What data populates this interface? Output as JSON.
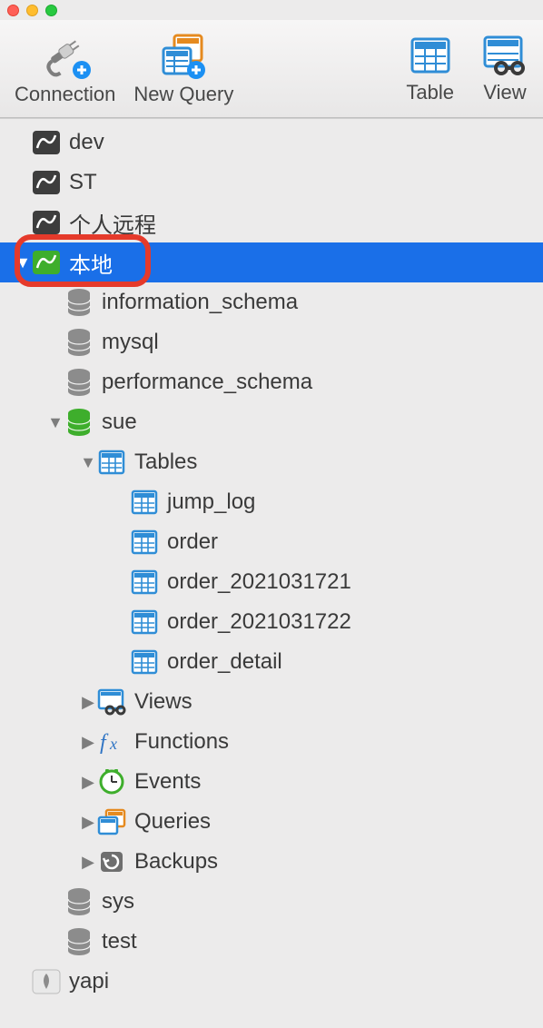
{
  "toolbar": {
    "connection": "Connection",
    "new_query": "New Query",
    "table": "Table",
    "view": "View"
  },
  "colors": {
    "selection": "#1a6fe8",
    "highlight_border": "#e53a2b",
    "db_active": "#3eae2c",
    "db_inactive": "#8c8c8c"
  },
  "tree": [
    {
      "indent": 0,
      "arrow": "",
      "icon": "mysql-dark",
      "label": "dev",
      "selected": false
    },
    {
      "indent": 0,
      "arrow": "",
      "icon": "mysql-dark",
      "label": "ST",
      "selected": false
    },
    {
      "indent": 0,
      "arrow": "",
      "icon": "mysql-dark",
      "label": "个人远程",
      "selected": false
    },
    {
      "indent": 0,
      "arrow": "down",
      "icon": "mysql-green",
      "label": "本地",
      "selected": true,
      "highlight": true
    },
    {
      "indent": 1,
      "arrow": "",
      "icon": "db-gray",
      "label": "information_schema",
      "selected": false
    },
    {
      "indent": 1,
      "arrow": "",
      "icon": "db-gray",
      "label": "mysql",
      "selected": false
    },
    {
      "indent": 1,
      "arrow": "",
      "icon": "db-gray",
      "label": "performance_schema",
      "selected": false
    },
    {
      "indent": 1,
      "arrow": "down",
      "icon": "db-green",
      "label": "sue",
      "selected": false
    },
    {
      "indent": 2,
      "arrow": "down",
      "icon": "table-blue",
      "label": "Tables",
      "selected": false
    },
    {
      "indent": 3,
      "arrow": "",
      "icon": "table-blue",
      "label": "jump_log",
      "selected": false
    },
    {
      "indent": 3,
      "arrow": "",
      "icon": "table-blue",
      "label": "order",
      "selected": false
    },
    {
      "indent": 3,
      "arrow": "",
      "icon": "table-blue",
      "label": "order_2021031721",
      "selected": false
    },
    {
      "indent": 3,
      "arrow": "",
      "icon": "table-blue",
      "label": "order_2021031722",
      "selected": false
    },
    {
      "indent": 3,
      "arrow": "",
      "icon": "table-blue",
      "label": "order_detail",
      "selected": false
    },
    {
      "indent": 2,
      "arrow": "right",
      "icon": "views",
      "label": "Views",
      "selected": false
    },
    {
      "indent": 2,
      "arrow": "right",
      "icon": "fx",
      "label": "Functions",
      "selected": false
    },
    {
      "indent": 2,
      "arrow": "right",
      "icon": "clock",
      "label": "Events",
      "selected": false
    },
    {
      "indent": 2,
      "arrow": "right",
      "icon": "queries",
      "label": "Queries",
      "selected": false
    },
    {
      "indent": 2,
      "arrow": "right",
      "icon": "backup",
      "label": "Backups",
      "selected": false
    },
    {
      "indent": 1,
      "arrow": "",
      "icon": "db-gray",
      "label": "sys",
      "selected": false
    },
    {
      "indent": 1,
      "arrow": "",
      "icon": "db-gray",
      "label": "test",
      "selected": false
    },
    {
      "indent": 0,
      "arrow": "",
      "icon": "mongo-gray",
      "label": "yapi",
      "selected": false
    }
  ]
}
